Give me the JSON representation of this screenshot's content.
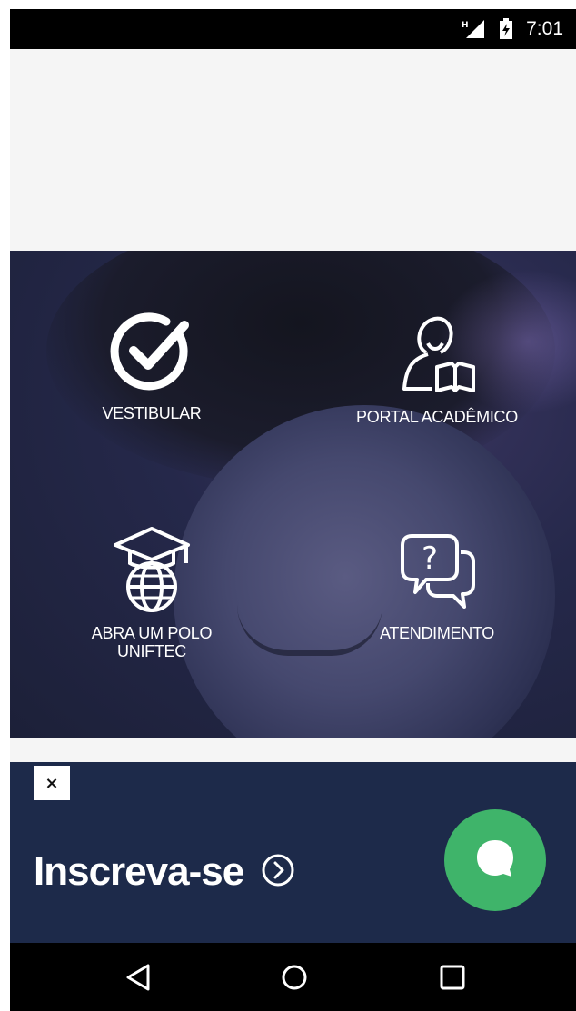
{
  "status_bar": {
    "time": "7:01",
    "signal_icon": "signal-h-icon",
    "battery_icon": "battery-charging-icon"
  },
  "tiles": [
    {
      "id": "vestibular",
      "label": "VESTIBULAR",
      "icon": "check-circle-icon"
    },
    {
      "id": "portal",
      "label": "PORTAL ACADÊMICO",
      "icon": "student-book-icon"
    },
    {
      "id": "polo",
      "label": "ABRA UM POLO UNIFTEC",
      "icon": "graduation-globe-icon"
    },
    {
      "id": "atendimento",
      "label": "ATENDIMENTO",
      "icon": "question-chat-icon"
    }
  ],
  "banner": {
    "close_label": "×",
    "cta_label": "Inscreva-se",
    "cta_icon": "chevron-right-circle-icon",
    "chat_icon": "chat-bubble-icon"
  },
  "nav_bar": {
    "back_icon": "back-triangle-icon",
    "home_icon": "home-circle-icon",
    "recent_icon": "recent-square-icon"
  },
  "colors": {
    "banner_bg": "#1d2a4a",
    "chat_fab": "#3fb46a",
    "hero_bg": "#25284a"
  }
}
